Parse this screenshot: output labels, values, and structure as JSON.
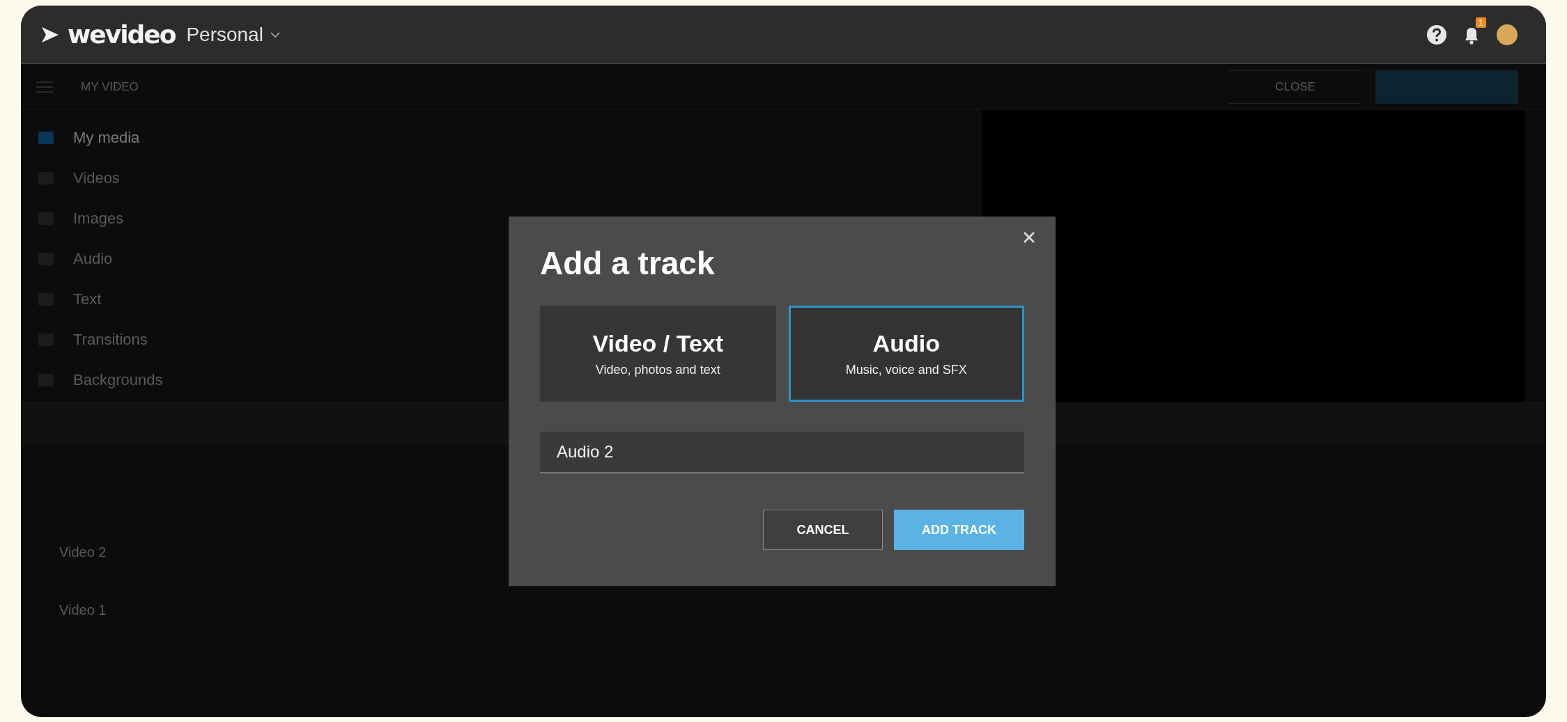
{
  "app": {
    "logo": "wevideo",
    "workspace": "Personal",
    "notification_count": "1"
  },
  "toolbar": {
    "tab": "MY VIDEO",
    "close_button": "CLOSE"
  },
  "sidebar": {
    "items": [
      {
        "label": "My media",
        "selected": true
      },
      {
        "label": "Videos",
        "selected": false
      },
      {
        "label": "Images",
        "selected": false
      },
      {
        "label": "Audio",
        "selected": false
      },
      {
        "label": "Text",
        "selected": false
      },
      {
        "label": "Transitions",
        "selected": false
      },
      {
        "label": "Backgrounds",
        "selected": false
      }
    ]
  },
  "tracks": [
    {
      "name": "Video 2"
    },
    {
      "name": "Video 1"
    }
  ],
  "dialog": {
    "title": "Add a track",
    "options": [
      {
        "title": "Video / Text",
        "subtitle": "Video, photos and text",
        "selected": false
      },
      {
        "title": "Audio",
        "subtitle": "Music, voice and SFX",
        "selected": true
      }
    ],
    "name_field": {
      "value": "Audio 2"
    },
    "buttons": [
      {
        "label": "CANCEL",
        "kind": "secondary"
      },
      {
        "label": "ADD TRACK",
        "kind": "primary"
      }
    ]
  }
}
